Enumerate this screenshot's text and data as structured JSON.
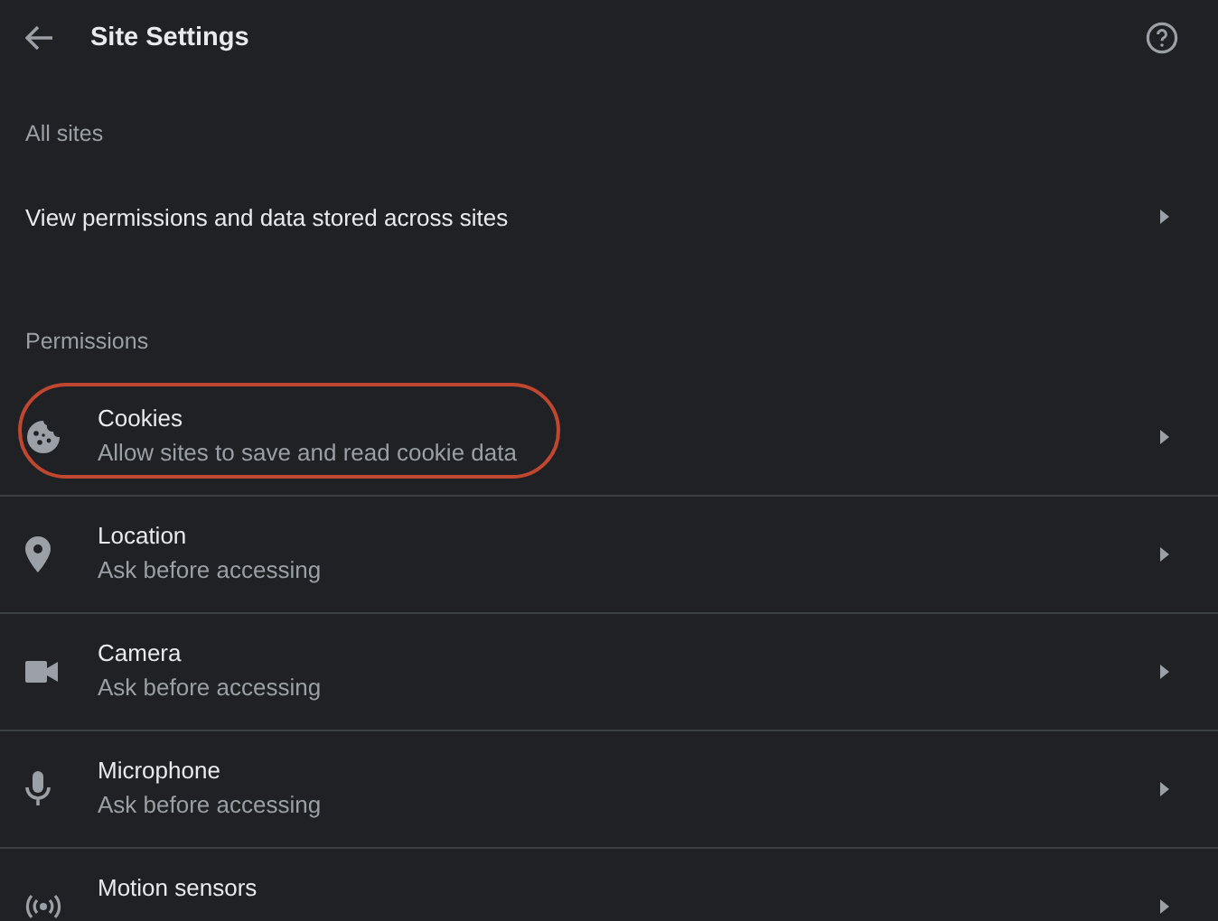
{
  "header": {
    "title": "Site Settings"
  },
  "all_sites": {
    "heading": "All sites",
    "link": "View permissions and data stored across sites"
  },
  "permissions": {
    "heading": "Permissions",
    "items": [
      {
        "kind": "cookie",
        "title": "Cookies",
        "subtitle": "Allow sites to save and read cookie data",
        "highlighted": true
      },
      {
        "kind": "location",
        "title": "Location",
        "subtitle": "Ask before accessing",
        "highlighted": false
      },
      {
        "kind": "camera",
        "title": "Camera",
        "subtitle": "Ask before accessing",
        "highlighted": false
      },
      {
        "kind": "microphone",
        "title": "Microphone",
        "subtitle": "Ask before accessing",
        "highlighted": false
      },
      {
        "kind": "motion",
        "title": "Motion sensors",
        "highlighted": false
      }
    ]
  }
}
